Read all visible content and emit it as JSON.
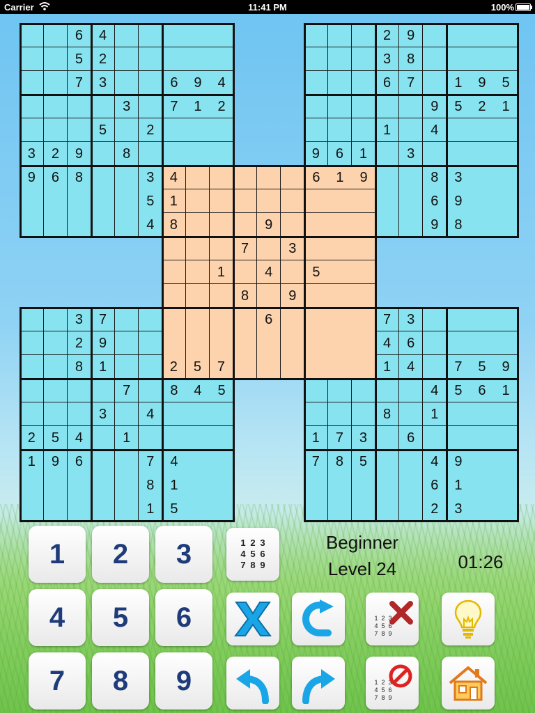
{
  "status_bar": {
    "carrier": "Carrier",
    "time": "11:41 PM",
    "battery": "100%"
  },
  "game": {
    "difficulty": "Beginner",
    "level": "Level 24",
    "timer": "01:26"
  },
  "colors": {
    "corner_grid": "#86e3ef",
    "center_grid": "#fdd3ad",
    "digit_button_text": "#1e3b7a"
  },
  "keypad": [
    "1",
    "2",
    "3",
    "4",
    "5",
    "6",
    "7",
    "8",
    "9"
  ],
  "note_grid_digits": [
    "1",
    "2",
    "3",
    "4",
    "5",
    "6",
    "7",
    "8",
    "9"
  ],
  "tools": {
    "note_mode": "note-grid-icon",
    "erase": "erase-x-icon",
    "redo_loop": "redo-loop-icon",
    "clear_notes": "clear-notes-icon",
    "hint": "lightbulb-icon",
    "undo": "undo-arrow-icon",
    "redo": "redo-arrow-icon",
    "clear_all_notes": "no-notes-icon",
    "home": "home-icon"
  },
  "grids": {
    "top_left": [
      [
        "",
        "",
        "6",
        "4",
        "",
        "",
        "",
        "",
        ""
      ],
      [
        "",
        "",
        "5",
        "2",
        "",
        "",
        "",
        "",
        ""
      ],
      [
        "",
        "",
        "7",
        "3",
        "",
        "",
        "6",
        "9",
        "4"
      ],
      [
        "",
        "",
        "",
        "",
        "3",
        "",
        "7",
        "1",
        "2"
      ],
      [
        "",
        "",
        "",
        "5",
        "",
        "2",
        "",
        "",
        ""
      ],
      [
        "3",
        "2",
        "9",
        "",
        "8",
        "",
        "",
        "",
        ""
      ],
      [
        "9",
        "6",
        "8",
        "",
        "",
        "3",
        "",
        "",
        ""
      ],
      [
        "",
        "",
        "",
        "",
        "",
        "5",
        "",
        "",
        ""
      ],
      [
        "",
        "",
        "",
        "",
        "",
        "4",
        "",
        "",
        ""
      ]
    ],
    "top_right": [
      [
        "",
        "",
        "",
        "2",
        "9",
        "",
        "",
        "",
        ""
      ],
      [
        "",
        "",
        "",
        "3",
        "8",
        "",
        "",
        "",
        ""
      ],
      [
        "",
        "",
        "",
        "6",
        "7",
        "",
        "1",
        "9",
        "5"
      ],
      [
        "",
        "",
        "",
        "",
        "",
        "9",
        "5",
        "2",
        "1"
      ],
      [
        "",
        "",
        "",
        "1",
        "",
        "4",
        "",
        "",
        ""
      ],
      [
        "9",
        "6",
        "1",
        "",
        "3",
        "",
        "",
        "",
        ""
      ],
      [
        "",
        "",
        "",
        "",
        "",
        "8",
        "3",
        "",
        ""
      ],
      [
        "",
        "",
        "",
        "",
        "",
        "6",
        "9",
        "",
        ""
      ],
      [
        "",
        "",
        "",
        "",
        "",
        "9",
        "8",
        "",
        ""
      ]
    ],
    "center": [
      [
        "4",
        "",
        "",
        "",
        "",
        "",
        "6",
        "1",
        "9"
      ],
      [
        "1",
        "",
        "",
        "",
        "",
        "",
        "",
        "",
        ""
      ],
      [
        "8",
        "",
        "",
        "",
        "9",
        "",
        "",
        "",
        ""
      ],
      [
        "",
        "",
        "",
        "7",
        "",
        "3",
        "",
        "",
        ""
      ],
      [
        "",
        "",
        "1",
        "",
        "4",
        "",
        "5",
        "",
        ""
      ],
      [
        "",
        "",
        "",
        "8",
        "",
        "9",
        "",
        "",
        ""
      ],
      [
        "",
        "",
        "",
        "",
        "6",
        "",
        "",
        "",
        ""
      ],
      [
        "",
        "",
        "",
        "",
        "",
        "",
        "",
        "",
        ""
      ],
      [
        "2",
        "5",
        "7",
        "",
        "",
        "",
        "",
        "",
        ""
      ]
    ],
    "bottom_left": [
      [
        "",
        "",
        "3",
        "7",
        "",
        "",
        "",
        "",
        ""
      ],
      [
        "",
        "",
        "2",
        "9",
        "",
        "",
        "",
        "",
        ""
      ],
      [
        "",
        "",
        "8",
        "1",
        "",
        "",
        "2",
        "5",
        "7"
      ],
      [
        "",
        "",
        "",
        "",
        "7",
        "",
        "8",
        "4",
        "5"
      ],
      [
        "",
        "",
        "",
        "3",
        "",
        "4",
        "",
        "",
        ""
      ],
      [
        "2",
        "5",
        "4",
        "",
        "1",
        "",
        "",
        "",
        ""
      ],
      [
        "1",
        "9",
        "6",
        "",
        "",
        "7",
        "4",
        "",
        ""
      ],
      [
        "",
        "",
        "",
        "",
        "",
        "8",
        "1",
        "",
        ""
      ],
      [
        "",
        "",
        "",
        "",
        "",
        "1",
        "5",
        "",
        ""
      ]
    ],
    "bottom_right": [
      [
        "",
        "",
        "",
        "7",
        "3",
        "",
        "",
        "",
        ""
      ],
      [
        "",
        "",
        "",
        "4",
        "6",
        "",
        "",
        "",
        ""
      ],
      [
        "",
        "",
        "",
        "1",
        "4",
        "",
        "7",
        "5",
        "9"
      ],
      [
        "",
        "",
        "",
        "",
        "",
        "4",
        "5",
        "6",
        "1"
      ],
      [
        "",
        "",
        "",
        "8",
        "",
        "1",
        "",
        "",
        ""
      ],
      [
        "1",
        "7",
        "3",
        "",
        "6",
        "",
        "",
        "",
        ""
      ],
      [
        "7",
        "8",
        "5",
        "",
        "",
        "4",
        "9",
        "",
        ""
      ],
      [
        "",
        "",
        "",
        "",
        "",
        "6",
        "1",
        "",
        ""
      ],
      [
        "",
        "",
        "",
        "",
        "",
        "2",
        "3",
        "",
        ""
      ]
    ]
  }
}
